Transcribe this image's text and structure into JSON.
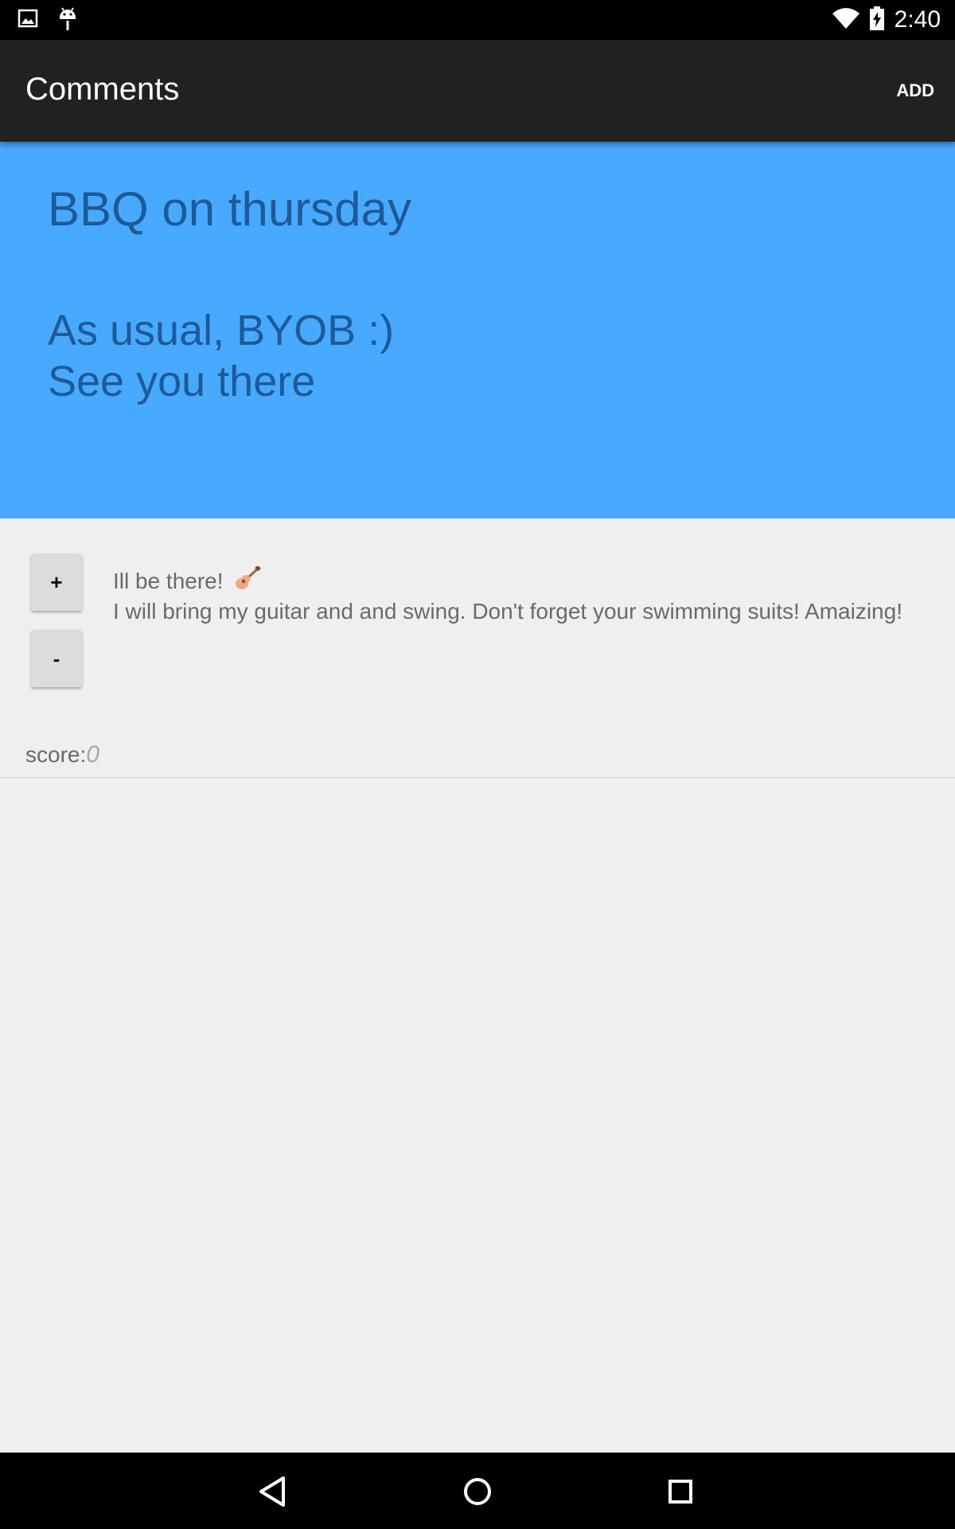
{
  "status_bar": {
    "time": "2:40",
    "icons": [
      "image-icon",
      "android-debug-icon",
      "wifi-icon",
      "battery-charging-icon"
    ]
  },
  "app_bar": {
    "title": "Comments",
    "add_label": "ADD"
  },
  "post": {
    "title": "BBQ on thursday",
    "body": "As usual, BYOB :)\nSee you there",
    "background": "#47a9ff",
    "text_color": "#1e5a96"
  },
  "comments": [
    {
      "upvote_label": "+",
      "downvote_label": "-",
      "title": "Ill be there!",
      "title_icon": "guitar-icon",
      "body": "I will bring my guitar and and swing. Don't forget your swimming suits! Amaizing!",
      "score_label": "score:",
      "score_value": "0"
    }
  ],
  "nav_bar": {
    "buttons": [
      "back-icon",
      "home-icon",
      "recents-icon"
    ]
  }
}
